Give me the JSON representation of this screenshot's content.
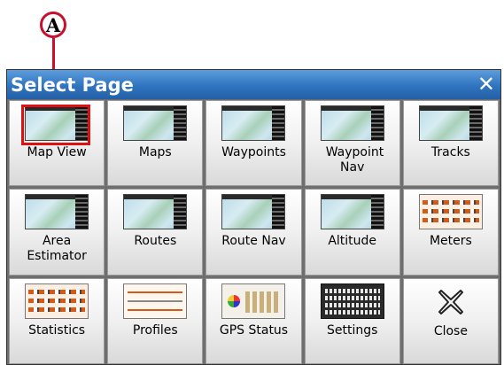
{
  "callout": {
    "letter": "A"
  },
  "window": {
    "title": "Select Page",
    "close_symbol": "✕"
  },
  "tiles": [
    {
      "label": "Map View",
      "icon": "map-view-thumbnail-icon",
      "highlighted": true
    },
    {
      "label": "Maps",
      "icon": "maps-thumbnail-icon"
    },
    {
      "label": "Waypoints",
      "icon": "waypoints-thumbnail-icon"
    },
    {
      "label": "Waypoint Nav",
      "icon": "waypoint-nav-thumbnail-icon"
    },
    {
      "label": "Tracks",
      "icon": "tracks-thumbnail-icon"
    },
    {
      "label": "Area Estimator",
      "icon": "area-estimator-thumbnail-icon"
    },
    {
      "label": "Routes",
      "icon": "routes-thumbnail-icon"
    },
    {
      "label": "Route Nav",
      "icon": "route-nav-thumbnail-icon"
    },
    {
      "label": "Altitude",
      "icon": "altitude-thumbnail-icon"
    },
    {
      "label": "Meters",
      "icon": "meters-thumbnail-icon"
    },
    {
      "label": "Statistics",
      "icon": "statistics-thumbnail-icon"
    },
    {
      "label": "Profiles",
      "icon": "profiles-thumbnail-icon"
    },
    {
      "label": "GPS Status",
      "icon": "gps-status-thumbnail-icon"
    },
    {
      "label": "Settings",
      "icon": "settings-thumbnail-icon"
    },
    {
      "label": "Close",
      "icon": "close-x-icon"
    }
  ],
  "colors": {
    "title_bar": "#2f74c0",
    "highlight": "#d11111",
    "callout": "#c8102e"
  }
}
